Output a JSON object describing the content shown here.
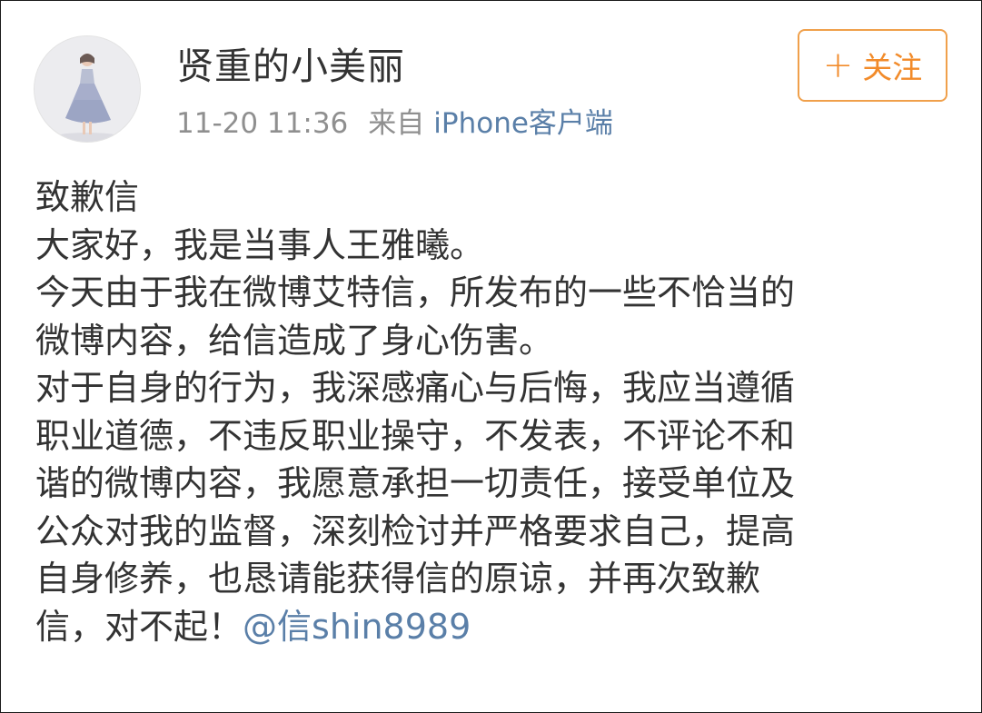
{
  "post": {
    "username": "贤重的小美丽",
    "time": "11-20 11:36",
    "from_label": "来自",
    "source": "iPhone客户端",
    "follow_label": "关注",
    "lines": [
      "致歉信",
      "大家好，我是当事人王雅曦。",
      "今天由于我在微博艾特信，所发布的一些不恰当的",
      "微博内容，给信造成了身心伤害。",
      "对于自身的行为，我深感痛心与后悔，我应当遵循",
      "职业道德，不违反职业操守，不发表，不评论不和",
      "谐的微博内容，我愿意承担一切责任，接受单位及",
      "公众对我的监督，深刻检讨并严格要求自己，提高",
      "自身修养，也恳请能获得信的原谅，并再次致歉"
    ],
    "last_line_text": "信，对不起！",
    "mention": "@信shin8989"
  },
  "colors": {
    "text": "#333333",
    "meta": "#8f8f8f",
    "link": "#5a7fa8",
    "follow_accent": "#f28b2a"
  },
  "icons": {
    "follow": "plus-icon",
    "avatar": "user-avatar-photo"
  }
}
